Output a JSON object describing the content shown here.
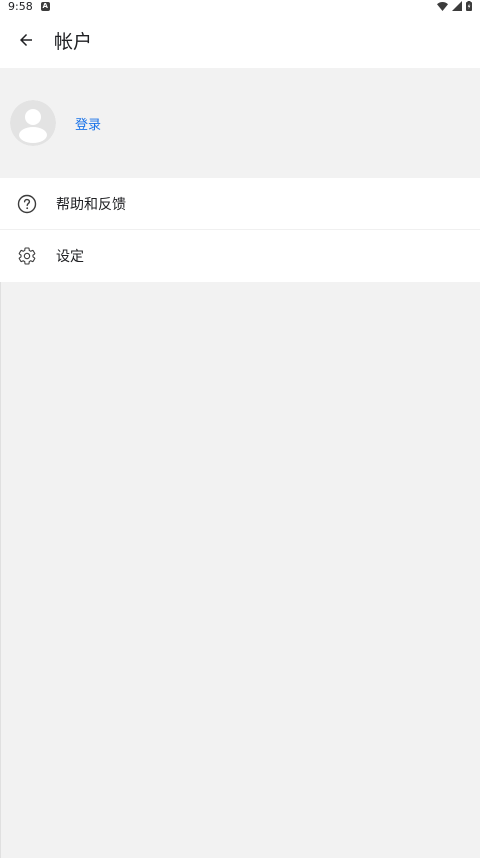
{
  "status_bar": {
    "time": "9:58",
    "notification_icon": "A"
  },
  "app_bar": {
    "back_icon": "arrow-back-icon",
    "title": "帐户"
  },
  "account": {
    "avatar_icon": "person-icon",
    "login_label": "登录"
  },
  "menu": {
    "items": [
      {
        "label": "帮助和反馈",
        "icon": "help-circle-icon"
      },
      {
        "label": "设定",
        "icon": "gear-icon"
      }
    ]
  },
  "colors": {
    "accent": "#1a73e8",
    "background": "#f2f2f2",
    "surface": "#ffffff"
  }
}
